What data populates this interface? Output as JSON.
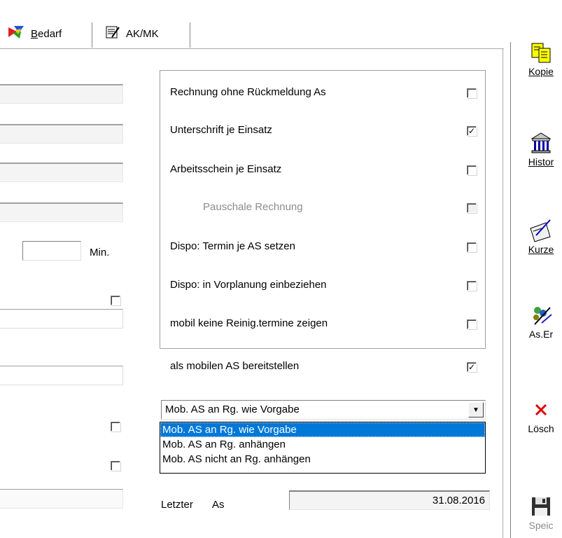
{
  "tabs": [
    {
      "label": "Bedarf",
      "underline": "B",
      "rest": "edarf",
      "icon": "bedarf-icon"
    },
    {
      "label": "AK/MK",
      "icon": "ak-mk-icon"
    }
  ],
  "left": {
    "min_label": "Min.",
    "min_value": ""
  },
  "options": [
    {
      "label": "Rechnung ohne Rückmeldung As",
      "checked": false,
      "enabled": true
    },
    {
      "label": "Unterschrift je Einsatz",
      "checked": true,
      "enabled": true
    },
    {
      "label": "Arbeitsschein je Einsatz",
      "checked": false,
      "enabled": true
    },
    {
      "label": "Pauschale Rechnung",
      "checked": false,
      "enabled": false
    },
    {
      "label": "Dispo: Termin je AS setzen",
      "checked": false,
      "enabled": true
    },
    {
      "label": "Dispo: in Vorplanung einbeziehen",
      "checked": false,
      "enabled": true
    },
    {
      "label": "mobil keine Reinig.termine zeigen",
      "checked": false,
      "enabled": true
    }
  ],
  "mobile_as": {
    "label": "als mobilen AS bereitstellen",
    "checked": true
  },
  "combo": {
    "selected": "Mob. AS an Rg. wie Vorgabe",
    "options": [
      "Mob. AS an Rg. wie Vorgabe",
      "Mob. AS an Rg. anhängen",
      "Mob. AS nicht an Rg. anhängen"
    ]
  },
  "letzter": {
    "label1": "Letzter",
    "label2": "As",
    "date": "31.08.2016"
  },
  "toolbar": [
    {
      "label": "Kopie",
      "icon": "copy-icon"
    },
    {
      "label": "Histor",
      "icon": "history-building-icon"
    },
    {
      "label": "Kurze",
      "icon": "note-pen-icon"
    },
    {
      "label": "As.Er",
      "icon": "as-erfassung-icon"
    },
    {
      "label": "Lösch",
      "icon": "delete-x-icon"
    },
    {
      "label": "Speic",
      "icon": "save-disk-icon"
    }
  ],
  "colors": {
    "selection": "#0078d7",
    "delete": "#e00000",
    "disabled_text": "#8c8c8c"
  }
}
